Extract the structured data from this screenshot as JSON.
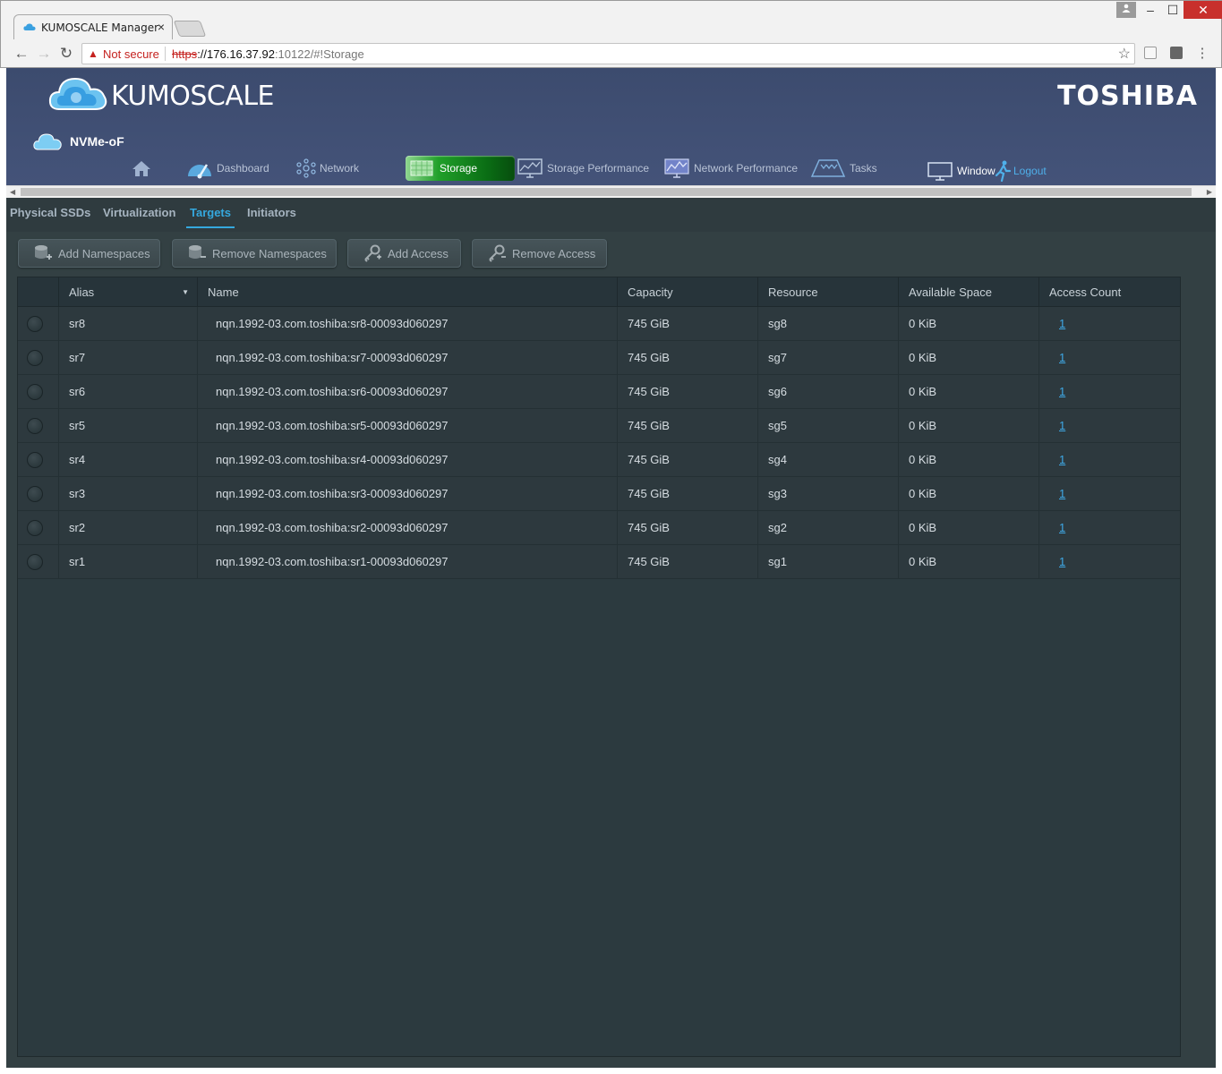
{
  "browser": {
    "tab_title": "KUMOSCALE Manager",
    "tab_close": "×",
    "security_label": "Not secure",
    "url_scheme": "https",
    "url_host": "://176.16.37.92",
    "url_path": ":10122/#!Storage",
    "win_min": "–",
    "win_max": "☐",
    "win_close": "✕"
  },
  "header": {
    "logo_text": "KUMOSCALE",
    "brand": "TOSHIBA",
    "product": "NVMe-oF"
  },
  "main_nav": {
    "dashboard": "Dashboard",
    "network": "Network",
    "storage": "Storage",
    "storage_performance": "Storage Performance",
    "network_performance": "Network Performance",
    "tasks": "Tasks",
    "window": "Window",
    "logout": "Logout"
  },
  "sub_tabs": [
    {
      "label": "Physical SSDs",
      "active": false
    },
    {
      "label": "Virtualization",
      "active": false
    },
    {
      "label": "Targets",
      "active": true
    },
    {
      "label": "Initiators",
      "active": false
    }
  ],
  "actions": {
    "add_namespaces": "Add Namespaces",
    "remove_namespaces": "Remove Namespaces",
    "add_access": "Add Access",
    "remove_access": "Remove Access"
  },
  "table": {
    "columns": {
      "alias": "Alias",
      "name": "Name",
      "capacity": "Capacity",
      "resource": "Resource",
      "available": "Available Space",
      "access_count": "Access Count"
    },
    "rows": [
      {
        "alias": "sr8",
        "name": "nqn.1992-03.com.toshiba:sr8-00093d060297",
        "capacity": "745 GiB",
        "resource": "sg8",
        "available": "0 KiB",
        "access_count": "1"
      },
      {
        "alias": "sr7",
        "name": "nqn.1992-03.com.toshiba:sr7-00093d060297",
        "capacity": "745 GiB",
        "resource": "sg7",
        "available": "0 KiB",
        "access_count": "1"
      },
      {
        "alias": "sr6",
        "name": "nqn.1992-03.com.toshiba:sr6-00093d060297",
        "capacity": "745 GiB",
        "resource": "sg6",
        "available": "0 KiB",
        "access_count": "1"
      },
      {
        "alias": "sr5",
        "name": "nqn.1992-03.com.toshiba:sr5-00093d060297",
        "capacity": "745 GiB",
        "resource": "sg5",
        "available": "0 KiB",
        "access_count": "1"
      },
      {
        "alias": "sr4",
        "name": "nqn.1992-03.com.toshiba:sr4-00093d060297",
        "capacity": "745 GiB",
        "resource": "sg4",
        "available": "0 KiB",
        "access_count": "1"
      },
      {
        "alias": "sr3",
        "name": "nqn.1992-03.com.toshiba:sr3-00093d060297",
        "capacity": "745 GiB",
        "resource": "sg3",
        "available": "0 KiB",
        "access_count": "1"
      },
      {
        "alias": "sr2",
        "name": "nqn.1992-03.com.toshiba:sr2-00093d060297",
        "capacity": "745 GiB",
        "resource": "sg2",
        "available": "0 KiB",
        "access_count": "1"
      },
      {
        "alias": "sr1",
        "name": "nqn.1992-03.com.toshiba:sr1-00093d060297",
        "capacity": "745 GiB",
        "resource": "sg1",
        "available": "0 KiB",
        "access_count": "1"
      }
    ]
  },
  "colors": {
    "header_bg": "#445379",
    "content_bg": "#334043",
    "storage_active": "#21a02a",
    "accent_blue": "#35a8de"
  }
}
